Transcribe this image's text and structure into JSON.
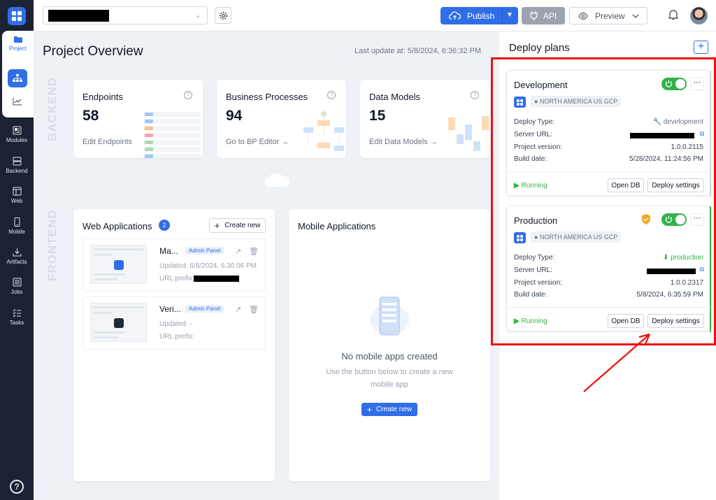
{
  "sidebar": {
    "items": [
      {
        "label": "Project",
        "icon": "folder-icon"
      },
      {
        "label": "Modules",
        "icon": "modules-icon"
      },
      {
        "label": "Backend",
        "icon": "database-icon"
      },
      {
        "label": "Web",
        "icon": "browser-icon"
      },
      {
        "label": "Mobile",
        "icon": "phone-icon"
      },
      {
        "label": "Artifacts",
        "icon": "download-icon"
      },
      {
        "label": "Jobs",
        "icon": "list-icon"
      },
      {
        "label": "Tasks",
        "icon": "checklist-icon"
      }
    ],
    "help": "?"
  },
  "topbar": {
    "publish": "Publish",
    "api": "API",
    "preview": "Preview"
  },
  "overview": {
    "title": "Project Overview",
    "last_update": "Last update at: 5/8/2024, 6:36:32 PM",
    "backend_label": "BACKEND",
    "frontend_label": "FRONTEND",
    "cards": [
      {
        "title": "Endpoints",
        "count": "58",
        "link": "Edit Endpoints"
      },
      {
        "title": "Business Processes",
        "count": "94",
        "link": "Go to BP Editor"
      },
      {
        "title": "Data Models",
        "count": "15",
        "link": "Edit Data Models"
      }
    ],
    "web": {
      "title": "Web Applications",
      "badge": "2",
      "create": "Create new",
      "apps": [
        {
          "name": "Ma...",
          "tag": "Admin Panel",
          "updated": "Updated: 6/8/2024, 6:36:06 PM",
          "prefix": "URL prefix:"
        },
        {
          "name": "Veri...",
          "tag": "Admin Panel",
          "updated": "Updated: -",
          "prefix": "URL prefix:"
        }
      ]
    },
    "mobile": {
      "title": "Mobile Applications",
      "empty_title": "No mobile apps created",
      "empty_sub": "Use the button below to create a new mobile app",
      "create": "Create new"
    }
  },
  "deploy": {
    "title": "Deploy plans",
    "plans": [
      {
        "name": "Development",
        "region": "NORTH AMERICA US GCP",
        "deploy_type_label": "Deploy Type:",
        "deploy_type": "development",
        "server_url_label": "Server URL:",
        "version_label": "Project version:",
        "version": "1.0.0.2115",
        "build_label": "Build date:",
        "build": "5/28/2024, 11:24:56 PM",
        "status": "Running",
        "open_db": "Open DB",
        "settings": "Deploy settings"
      },
      {
        "name": "Production",
        "region": "NORTH AMERICA US GCP",
        "deploy_type_label": "Deploy Type:",
        "deploy_type": "production",
        "server_url_label": "Server URL:",
        "version_label": "Project version:",
        "version": "1.0.0.2317",
        "build_label": "Build date:",
        "build": "5/8/2024, 6:35:59 PM",
        "status": "Running",
        "open_db": "Open DB",
        "settings": "Deploy settings"
      }
    ]
  },
  "colors": {
    "accent": "#2f6ee6",
    "sidebar": "#1a2233",
    "running": "#33b249",
    "highlight": "#ee1111"
  }
}
